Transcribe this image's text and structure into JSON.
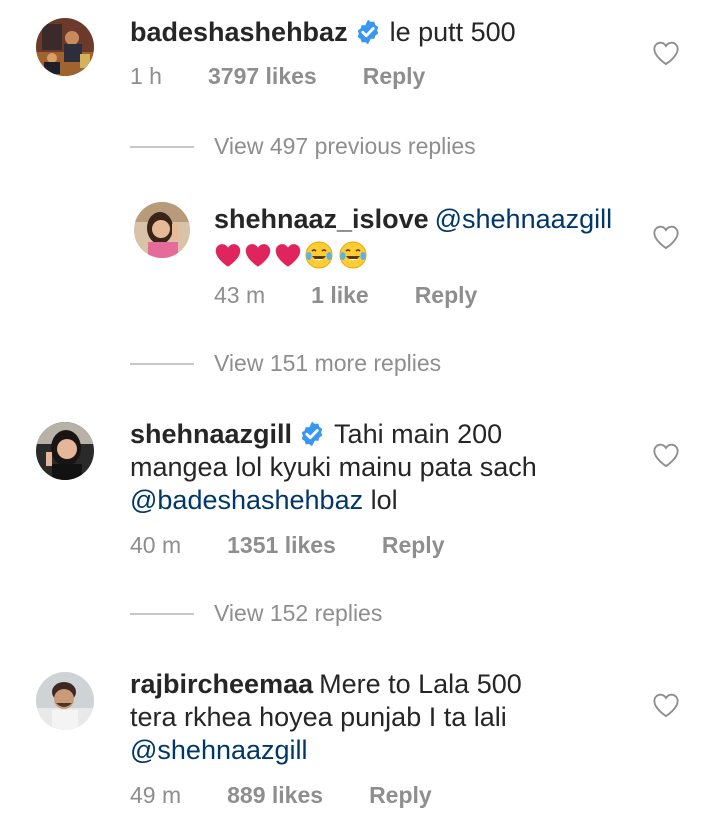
{
  "comments": [
    {
      "username": "badeshashehbaz",
      "verified": true,
      "text": "le putt 500",
      "time": "1 h",
      "likes": "3797 likes",
      "reply": "Reply",
      "view_replies": "View 497 previous replies"
    },
    {
      "username": "shehnaaz_islove",
      "verified": false,
      "mention": "@shehnaazgill",
      "emoji": [
        "red-heart",
        "red-heart",
        "red-heart",
        "tears-of-joy",
        "tears-of-joy"
      ],
      "time": "43 m",
      "likes": "1 like",
      "reply": "Reply",
      "view_replies": "View 151 more replies"
    },
    {
      "username": "shehnaazgill",
      "verified": true,
      "text_line1": "Tahi main 200",
      "text_line2": "mangea lol kyuki mainu pata sach",
      "mention": "@badeshashehbaz",
      "text_tail": "lol",
      "time": "40 m",
      "likes": "1351 likes",
      "reply": "Reply",
      "view_replies": "View 152 replies"
    },
    {
      "username": "rajbircheemaa",
      "verified": false,
      "text_line1": "Mere to Lala 500",
      "text_line2": "tera rkhea hoyea punjab I ta lali",
      "mention": "@shehnaazgill",
      "time": "49 m",
      "likes": "889 likes",
      "reply": "Reply"
    }
  ],
  "colors": {
    "text": "#262626",
    "meta": "#8e8e8e",
    "mention": "#00376b",
    "verified": "#3897f0",
    "heart_emoji": "#e0245e"
  },
  "icons": {
    "like": "heart-outline-icon",
    "verified": "verified-badge-icon"
  }
}
